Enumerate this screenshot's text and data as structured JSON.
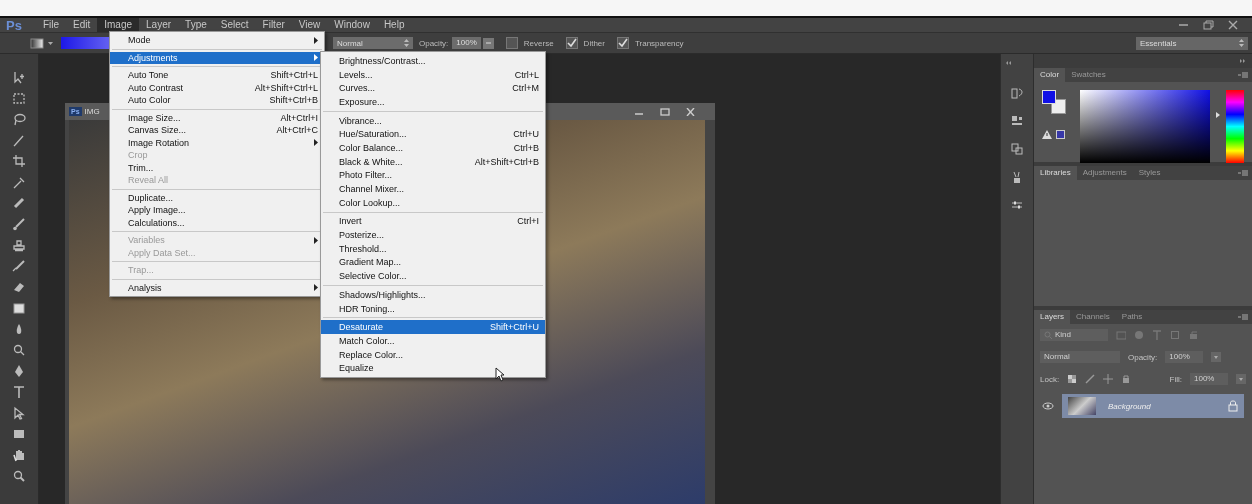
{
  "menu_bar": {
    "logo": "Ps",
    "items": [
      {
        "label": "File",
        "selected": false
      },
      {
        "label": "Edit",
        "selected": false
      },
      {
        "label": "Image",
        "selected": true
      },
      {
        "label": "Layer",
        "selected": false
      },
      {
        "label": "Type",
        "selected": false
      },
      {
        "label": "Select",
        "selected": false
      },
      {
        "label": "Filter",
        "selected": false
      },
      {
        "label": "View",
        "selected": false
      },
      {
        "label": "Window",
        "selected": false
      },
      {
        "label": "Help",
        "selected": false
      }
    ]
  },
  "options_bar": {
    "mode": "Normal",
    "opacity_label": "Opacity:",
    "opacity": "100%",
    "options": [
      {
        "label": "Reverse",
        "checked": false
      },
      {
        "label": "Dither",
        "checked": true
      },
      {
        "label": "Transparency",
        "checked": true
      }
    ],
    "workspace": "Essentials"
  },
  "document": {
    "logo": "Ps",
    "title": "IMG"
  },
  "image_menu": {
    "items": [
      {
        "kind": "item",
        "label": "Mode",
        "submenu": true,
        "disabled": false,
        "selected": false
      },
      {
        "kind": "separator"
      },
      {
        "kind": "item",
        "label": "Adjustments",
        "submenu": true,
        "disabled": false,
        "selected": true
      },
      {
        "kind": "separator"
      },
      {
        "kind": "item",
        "label": "Auto Tone",
        "shortcut": "Shift+Ctrl+L",
        "submenu": false,
        "disabled": false,
        "selected": false
      },
      {
        "kind": "item",
        "label": "Auto Contrast",
        "shortcut": "Alt+Shift+Ctrl+L",
        "submenu": false,
        "disabled": false,
        "selected": false
      },
      {
        "kind": "item",
        "label": "Auto Color",
        "shortcut": "Shift+Ctrl+B",
        "submenu": false,
        "disabled": false,
        "selected": false
      },
      {
        "kind": "separator"
      },
      {
        "kind": "item",
        "label": "Image Size...",
        "shortcut": "Alt+Ctrl+I",
        "submenu": false,
        "disabled": false,
        "selected": false
      },
      {
        "kind": "item",
        "label": "Canvas Size...",
        "shortcut": "Alt+Ctrl+C",
        "submenu": false,
        "disabled": false,
        "selected": false
      },
      {
        "kind": "item",
        "label": "Image Rotation",
        "submenu": true,
        "disabled": false,
        "selected": false
      },
      {
        "kind": "item",
        "label": "Crop",
        "submenu": false,
        "disabled": true,
        "selected": false
      },
      {
        "kind": "item",
        "label": "Trim...",
        "submenu": false,
        "disabled": false,
        "selected": false
      },
      {
        "kind": "item",
        "label": "Reveal All",
        "submenu": false,
        "disabled": true,
        "selected": false
      },
      {
        "kind": "separator"
      },
      {
        "kind": "item",
        "label": "Duplicate...",
        "submenu": false,
        "disabled": false,
        "selected": false
      },
      {
        "kind": "item",
        "label": "Apply Image...",
        "submenu": false,
        "disabled": false,
        "selected": false
      },
      {
        "kind": "item",
        "label": "Calculations...",
        "submenu": false,
        "disabled": false,
        "selected": false
      },
      {
        "kind": "separator"
      },
      {
        "kind": "item",
        "label": "Variables",
        "submenu": true,
        "disabled": true,
        "selected": false
      },
      {
        "kind": "item",
        "label": "Apply Data Set...",
        "submenu": false,
        "disabled": true,
        "selected": false
      },
      {
        "kind": "separator"
      },
      {
        "kind": "item",
        "label": "Trap...",
        "submenu": false,
        "disabled": true,
        "selected": false
      },
      {
        "kind": "separator"
      },
      {
        "kind": "item",
        "label": "Analysis",
        "submenu": true,
        "disabled": false,
        "selected": false
      }
    ]
  },
  "adjustments_menu": {
    "items": [
      {
        "kind": "item",
        "label": "Brightness/Contrast...",
        "submenu": false,
        "disabled": false,
        "selected": false
      },
      {
        "kind": "item",
        "label": "Levels...",
        "shortcut": "Ctrl+L",
        "submenu": false,
        "disabled": false,
        "selected": false
      },
      {
        "kind": "item",
        "label": "Curves...",
        "shortcut": "Ctrl+M",
        "submenu": false,
        "disabled": false,
        "selected": false
      },
      {
        "kind": "item",
        "label": "Exposure...",
        "submenu": false,
        "disabled": false,
        "selected": false
      },
      {
        "kind": "separator"
      },
      {
        "kind": "item",
        "label": "Vibrance...",
        "submenu": false,
        "disabled": false,
        "selected": false
      },
      {
        "kind": "item",
        "label": "Hue/Saturation...",
        "shortcut": "Ctrl+U",
        "submenu": false,
        "disabled": false,
        "selected": false
      },
      {
        "kind": "item",
        "label": "Color Balance...",
        "shortcut": "Ctrl+B",
        "submenu": false,
        "disabled": false,
        "selected": false
      },
      {
        "kind": "item",
        "label": "Black & White...",
        "shortcut": "Alt+Shift+Ctrl+B",
        "submenu": false,
        "disabled": false,
        "selected": false
      },
      {
        "kind": "item",
        "label": "Photo Filter...",
        "submenu": false,
        "disabled": false,
        "selected": false
      },
      {
        "kind": "item",
        "label": "Channel Mixer...",
        "submenu": false,
        "disabled": false,
        "selected": false
      },
      {
        "kind": "item",
        "label": "Color Lookup...",
        "submenu": false,
        "disabled": false,
        "selected": false
      },
      {
        "kind": "separator"
      },
      {
        "kind": "item",
        "label": "Invert",
        "shortcut": "Ctrl+I",
        "submenu": false,
        "disabled": false,
        "selected": false
      },
      {
        "kind": "item",
        "label": "Posterize...",
        "submenu": false,
        "disabled": false,
        "selected": false
      },
      {
        "kind": "item",
        "label": "Threshold...",
        "submenu": false,
        "disabled": false,
        "selected": false
      },
      {
        "kind": "item",
        "label": "Gradient Map...",
        "submenu": false,
        "disabled": false,
        "selected": false
      },
      {
        "kind": "item",
        "label": "Selective Color...",
        "submenu": false,
        "disabled": false,
        "selected": false
      },
      {
        "kind": "separator"
      },
      {
        "kind": "item",
        "label": "Shadows/Highlights...",
        "submenu": false,
        "disabled": false,
        "selected": false
      },
      {
        "kind": "item",
        "label": "HDR Toning...",
        "submenu": false,
        "disabled": false,
        "selected": false
      },
      {
        "kind": "separator"
      },
      {
        "kind": "item",
        "label": "Desaturate",
        "shortcut": "Shift+Ctrl+U",
        "submenu": false,
        "disabled": false,
        "selected": true
      },
      {
        "kind": "item",
        "label": "Match Color...",
        "submenu": false,
        "disabled": false,
        "selected": false
      },
      {
        "kind": "item",
        "label": "Replace Color...",
        "submenu": false,
        "disabled": false,
        "selected": false
      },
      {
        "kind": "item",
        "label": "Equalize",
        "submenu": false,
        "disabled": false,
        "selected": false
      }
    ]
  },
  "color_panel": {
    "tabs": [
      {
        "label": "Color",
        "selected": true
      },
      {
        "label": "Swatches",
        "selected": false
      }
    ]
  },
  "libraries_panel": {
    "tabs": [
      {
        "label": "Libraries",
        "selected": true
      },
      {
        "label": "Adjustments",
        "selected": false
      },
      {
        "label": "Styles",
        "selected": false
      }
    ]
  },
  "layers_panel": {
    "tabs": [
      {
        "label": "Layers",
        "selected": true
      },
      {
        "label": "Channels",
        "selected": false
      },
      {
        "label": "Paths",
        "selected": false
      }
    ],
    "filter": "Kind",
    "blend_mode": "Normal",
    "opacity_label": "Opacity:",
    "opacity": "100%",
    "lock_label": "Lock:",
    "fill_label": "Fill:",
    "fill": "100%",
    "layers": [
      {
        "name": "Background",
        "visible": true,
        "selected": true,
        "locked": true
      }
    ]
  }
}
